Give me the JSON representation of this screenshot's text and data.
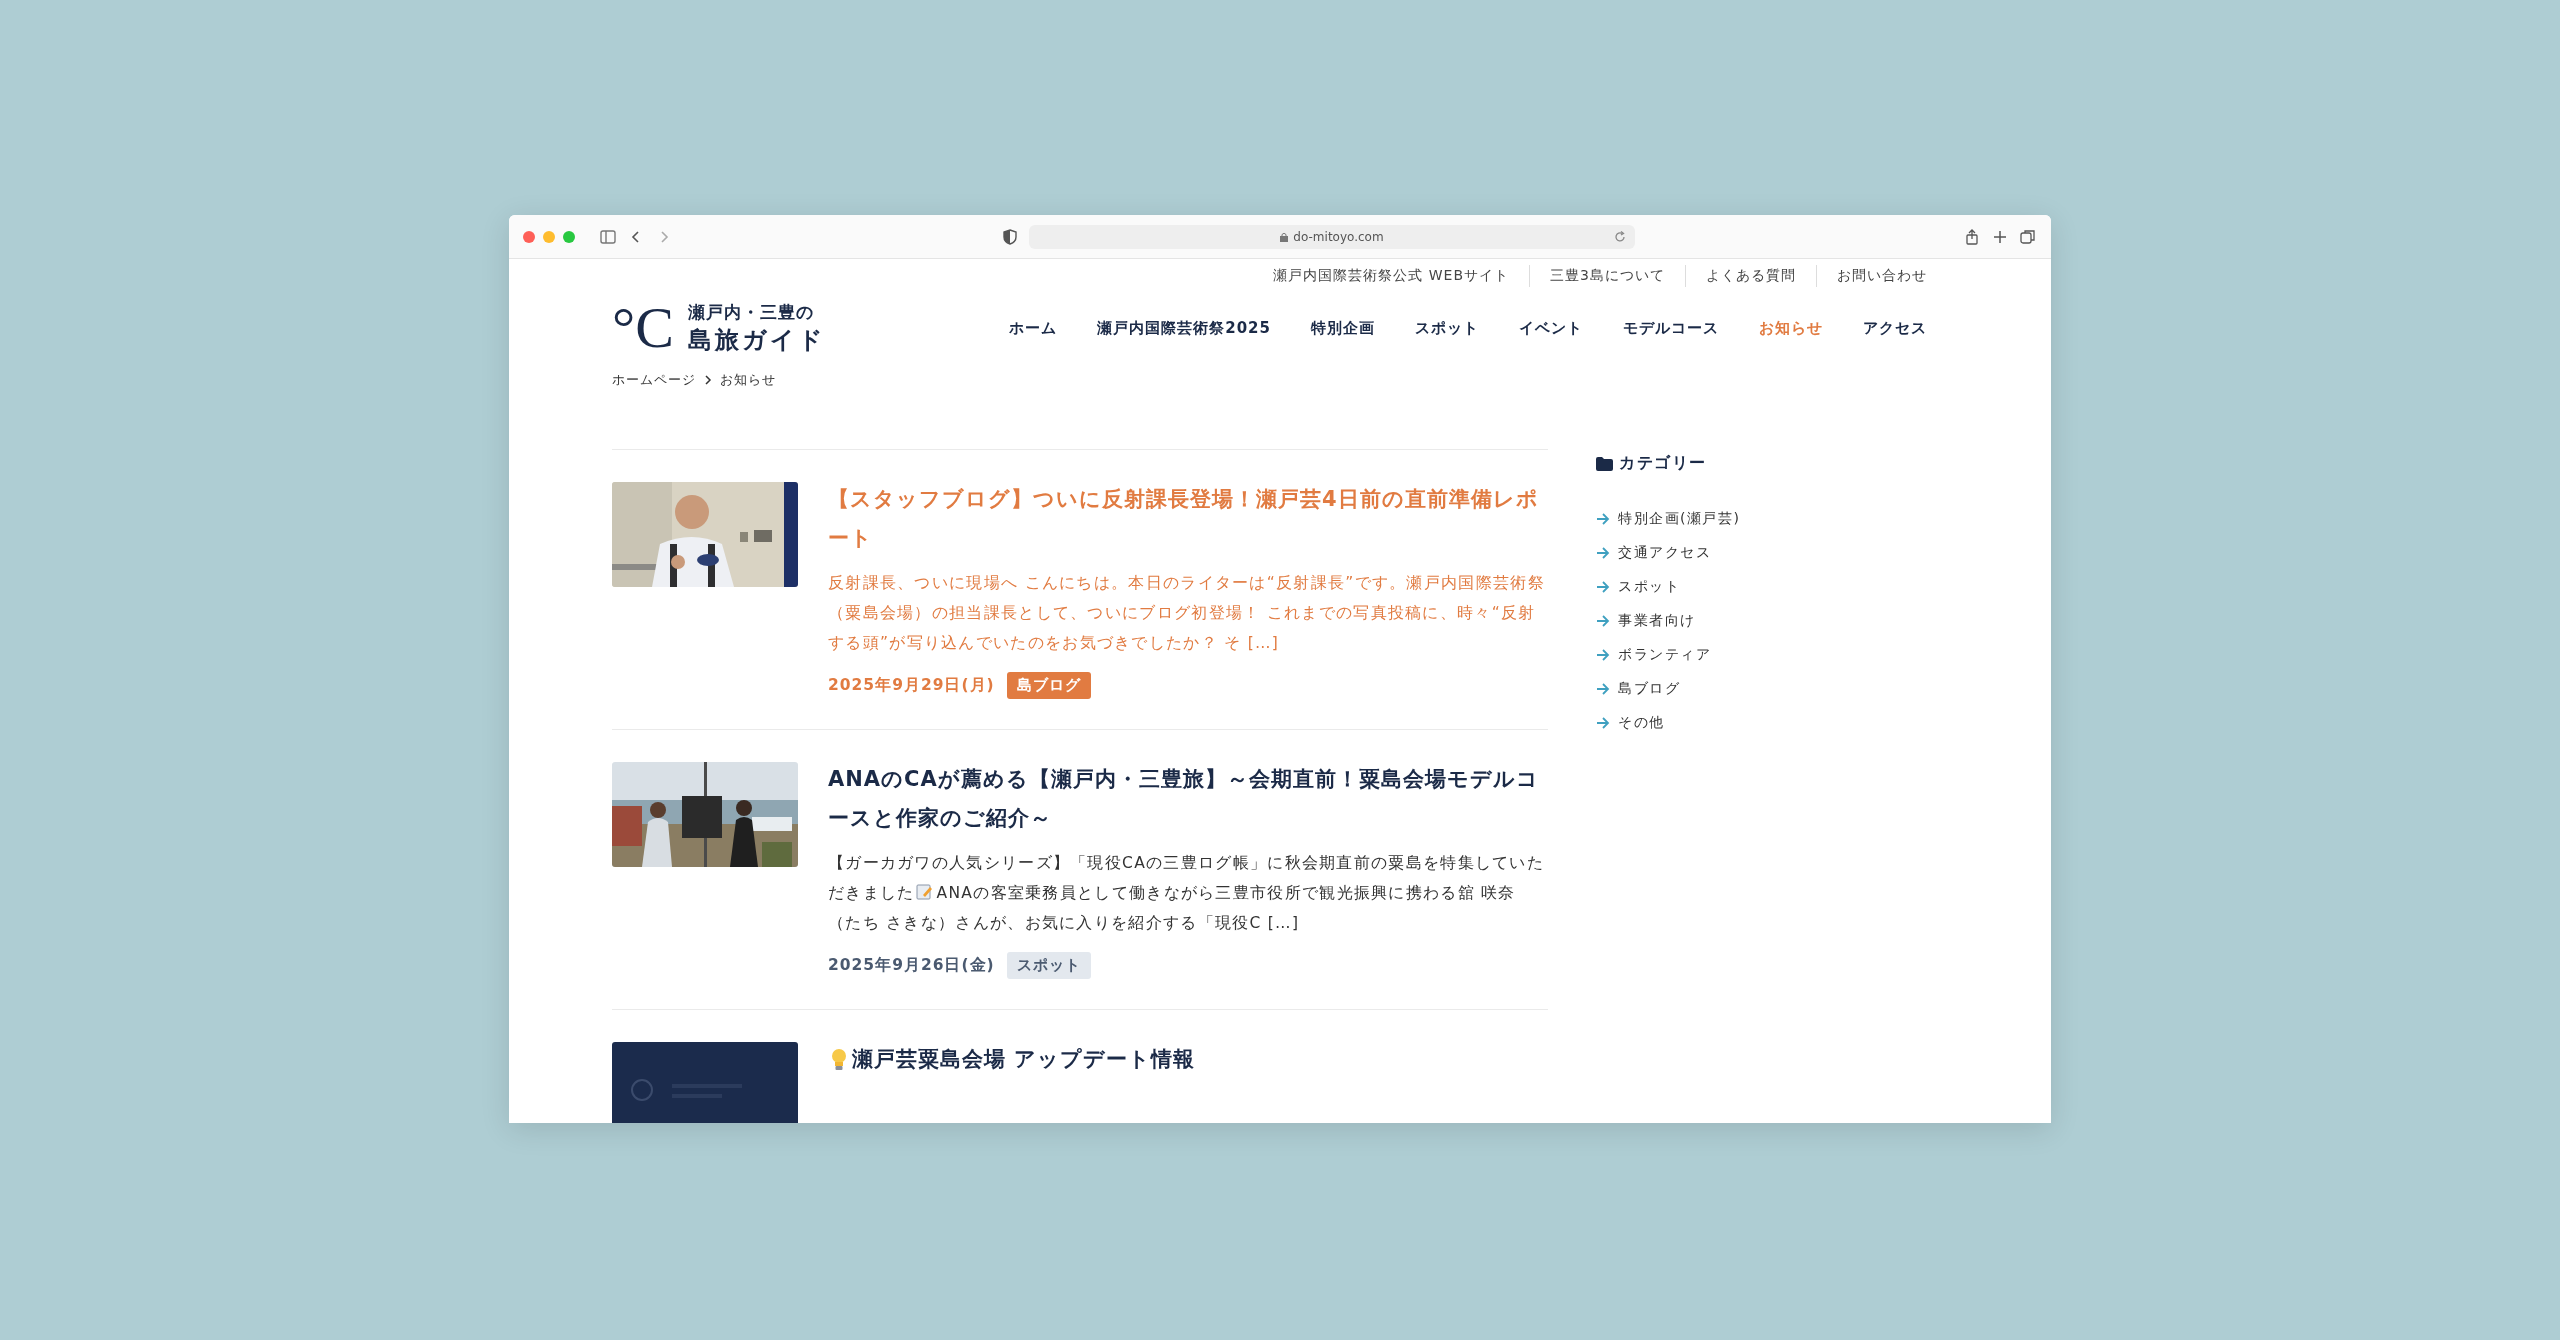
{
  "browser": {
    "url": "do-mitoyo.com"
  },
  "utility_links": [
    "瀬戸内国際芸術祭公式 WEBサイト",
    "三豊3島について",
    "よくある質問",
    "お問い合わせ"
  ],
  "logo": {
    "mark": "°C",
    "line1": "瀬戸内・三豊の",
    "line2": "島旅ガイド"
  },
  "nav": [
    {
      "label": "ホーム",
      "selected": false
    },
    {
      "label": "瀬戸内国際芸術祭2025",
      "selected": false
    },
    {
      "label": "特別企画",
      "selected": false
    },
    {
      "label": "スポット",
      "selected": false
    },
    {
      "label": "イベント",
      "selected": false
    },
    {
      "label": "モデルコース",
      "selected": false
    },
    {
      "label": "お知らせ",
      "selected": true
    },
    {
      "label": "アクセス",
      "selected": false
    }
  ],
  "breadcrumb": [
    "ホームページ",
    "お知らせ"
  ],
  "posts": [
    {
      "kind": "plain",
      "highlighted": true,
      "title": "【スタッフブログ】ついに反射課長登場！瀬戸芸4日前の直前準備レポート",
      "excerpt": [
        "反射課長、ついに現場へ こんにちは。本日のライターは“反射課長”です。瀬戸内国際芸術祭（粟島会場）の担当課長として、ついにブログ初登場！ これまでの写真投稿に、時々“反射する頭”が写り込んでいたのをお気づきでしたか？ そ […]"
      ],
      "date": "2025年9月29日(月)",
      "category": "島ブログ"
    },
    {
      "kind": "plain",
      "highlighted": false,
      "title": "ANAのCAが薦める【瀬戸内・三豊旅】～会期直前！粟島会場モデルコースと作家のご紹介～",
      "excerpt_lines": [
        [
          "【ガーカガワの人気シリーズ】「現役CAの三豊ログ帳」に秋会期直前の粟島を特集していた"
        ],
        [
          "だきました",
          "ANAの客室乗務員として働きながら三豊市役所で観光振興に携わる舘 咲奈"
        ],
        [
          "（たち さきな）さんが、お気に入りを紹介する「現役C […]"
        ]
      ],
      "date": "2025年9月26日(金)",
      "category": "スポット"
    },
    {
      "kind": "lead-icon",
      "highlighted": false,
      "title": "瀬戸芸粟島会場 アップデート情報"
    }
  ],
  "sidebar": {
    "heading": "カテゴリー",
    "categories": [
      "特別企画(瀬戸芸)",
      "交通アクセス",
      "スポット",
      "事業者向け",
      "ボランティア",
      "島ブログ",
      "その他"
    ]
  }
}
